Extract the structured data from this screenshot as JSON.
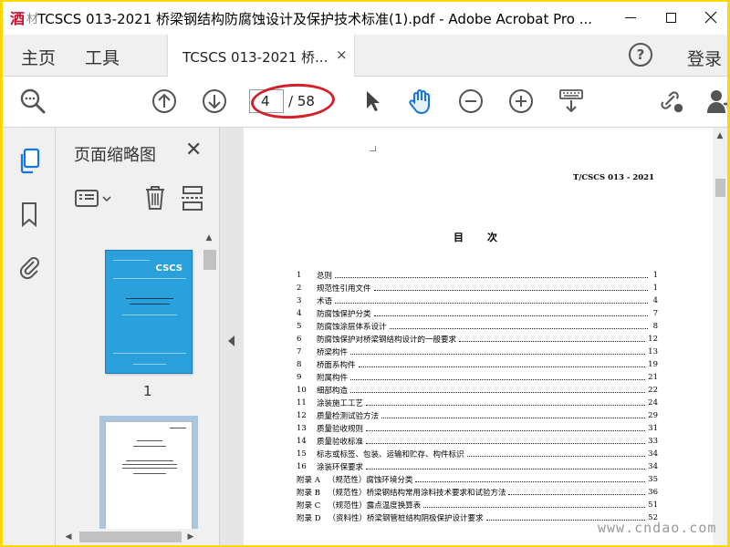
{
  "window": {
    "title": "TCSCS 013-2021 桥梁钢结构防腐蚀设计及保护技术标准(1).pdf - Adobe Acrobat Pro ...",
    "logo_text": "酒",
    "logo_text2": "材"
  },
  "nav": {
    "home": "主页",
    "tools": "工具",
    "doc_tab": "TCSCS 013-2021 桥...",
    "doc_tab_close": "×",
    "help": "?",
    "login": "登录"
  },
  "toolbar": {
    "current_page": "4",
    "page_total": "/ 58",
    "icons": [
      "zoom-search-icon",
      "page-up-icon",
      "page-down-icon",
      "select-arrow-icon",
      "hand-tool-icon",
      "zoom-out-icon",
      "zoom-in-icon",
      "keyboard-scroll-icon",
      "link-share-icon",
      "user-add-icon"
    ],
    "highlight_color": "#d3202a"
  },
  "rail": {
    "icons": [
      "page-thumbnails-icon",
      "bookmark-icon",
      "attachment-icon"
    ]
  },
  "thumbnails": {
    "title": "页面缩略图",
    "close": "✕",
    "pages": [
      {
        "number": "1",
        "cover_label": "CSCS"
      }
    ]
  },
  "document": {
    "header": "T/CSCS 013 - 2021",
    "toc_title": "目次",
    "toc": [
      {
        "num": "1",
        "text": "总则",
        "page": "1"
      },
      {
        "num": "2",
        "text": "规范性引用文件",
        "page": "1"
      },
      {
        "num": "3",
        "text": "术语",
        "page": "4"
      },
      {
        "num": "4",
        "text": "防腐蚀保护分类",
        "page": "7"
      },
      {
        "num": "5",
        "text": "防腐蚀涂层体系设计",
        "page": "8"
      },
      {
        "num": "6",
        "text": "防腐蚀保护对桥梁钢结构设计的一般要求",
        "page": "12"
      },
      {
        "num": "7",
        "text": "桥梁构件",
        "page": "13"
      },
      {
        "num": "8",
        "text": "桥面系构件",
        "page": "19"
      },
      {
        "num": "9",
        "text": "附属构件",
        "page": "21"
      },
      {
        "num": "10",
        "text": "细部构造",
        "page": "22"
      },
      {
        "num": "11",
        "text": "涂装施工工艺",
        "page": "24"
      },
      {
        "num": "12",
        "text": "质量检测试验方法",
        "page": "29"
      },
      {
        "num": "13",
        "text": "质量验收规则",
        "page": "31"
      },
      {
        "num": "14",
        "text": "质量验收标准",
        "page": "33"
      },
      {
        "num": "15",
        "text": "标志或标签、包装、运输和贮存、构件标识",
        "page": "34"
      },
      {
        "num": "16",
        "text": "涂装环保要求",
        "page": "34"
      },
      {
        "num": "附录 A",
        "text": "（规范性）腐蚀环境分类",
        "page": "35"
      },
      {
        "num": "附录 B",
        "text": "（规范性）桥梁钢结构常用涂料技术要求和试验方法",
        "page": "36"
      },
      {
        "num": "附录 C",
        "text": "（规范性）露点温度换算表",
        "page": "51"
      },
      {
        "num": "附录 D",
        "text": "（资料性）桥梁钢管桩结构阴极保护设计要求",
        "page": "52"
      }
    ]
  },
  "watermark": "www.cndao.com"
}
